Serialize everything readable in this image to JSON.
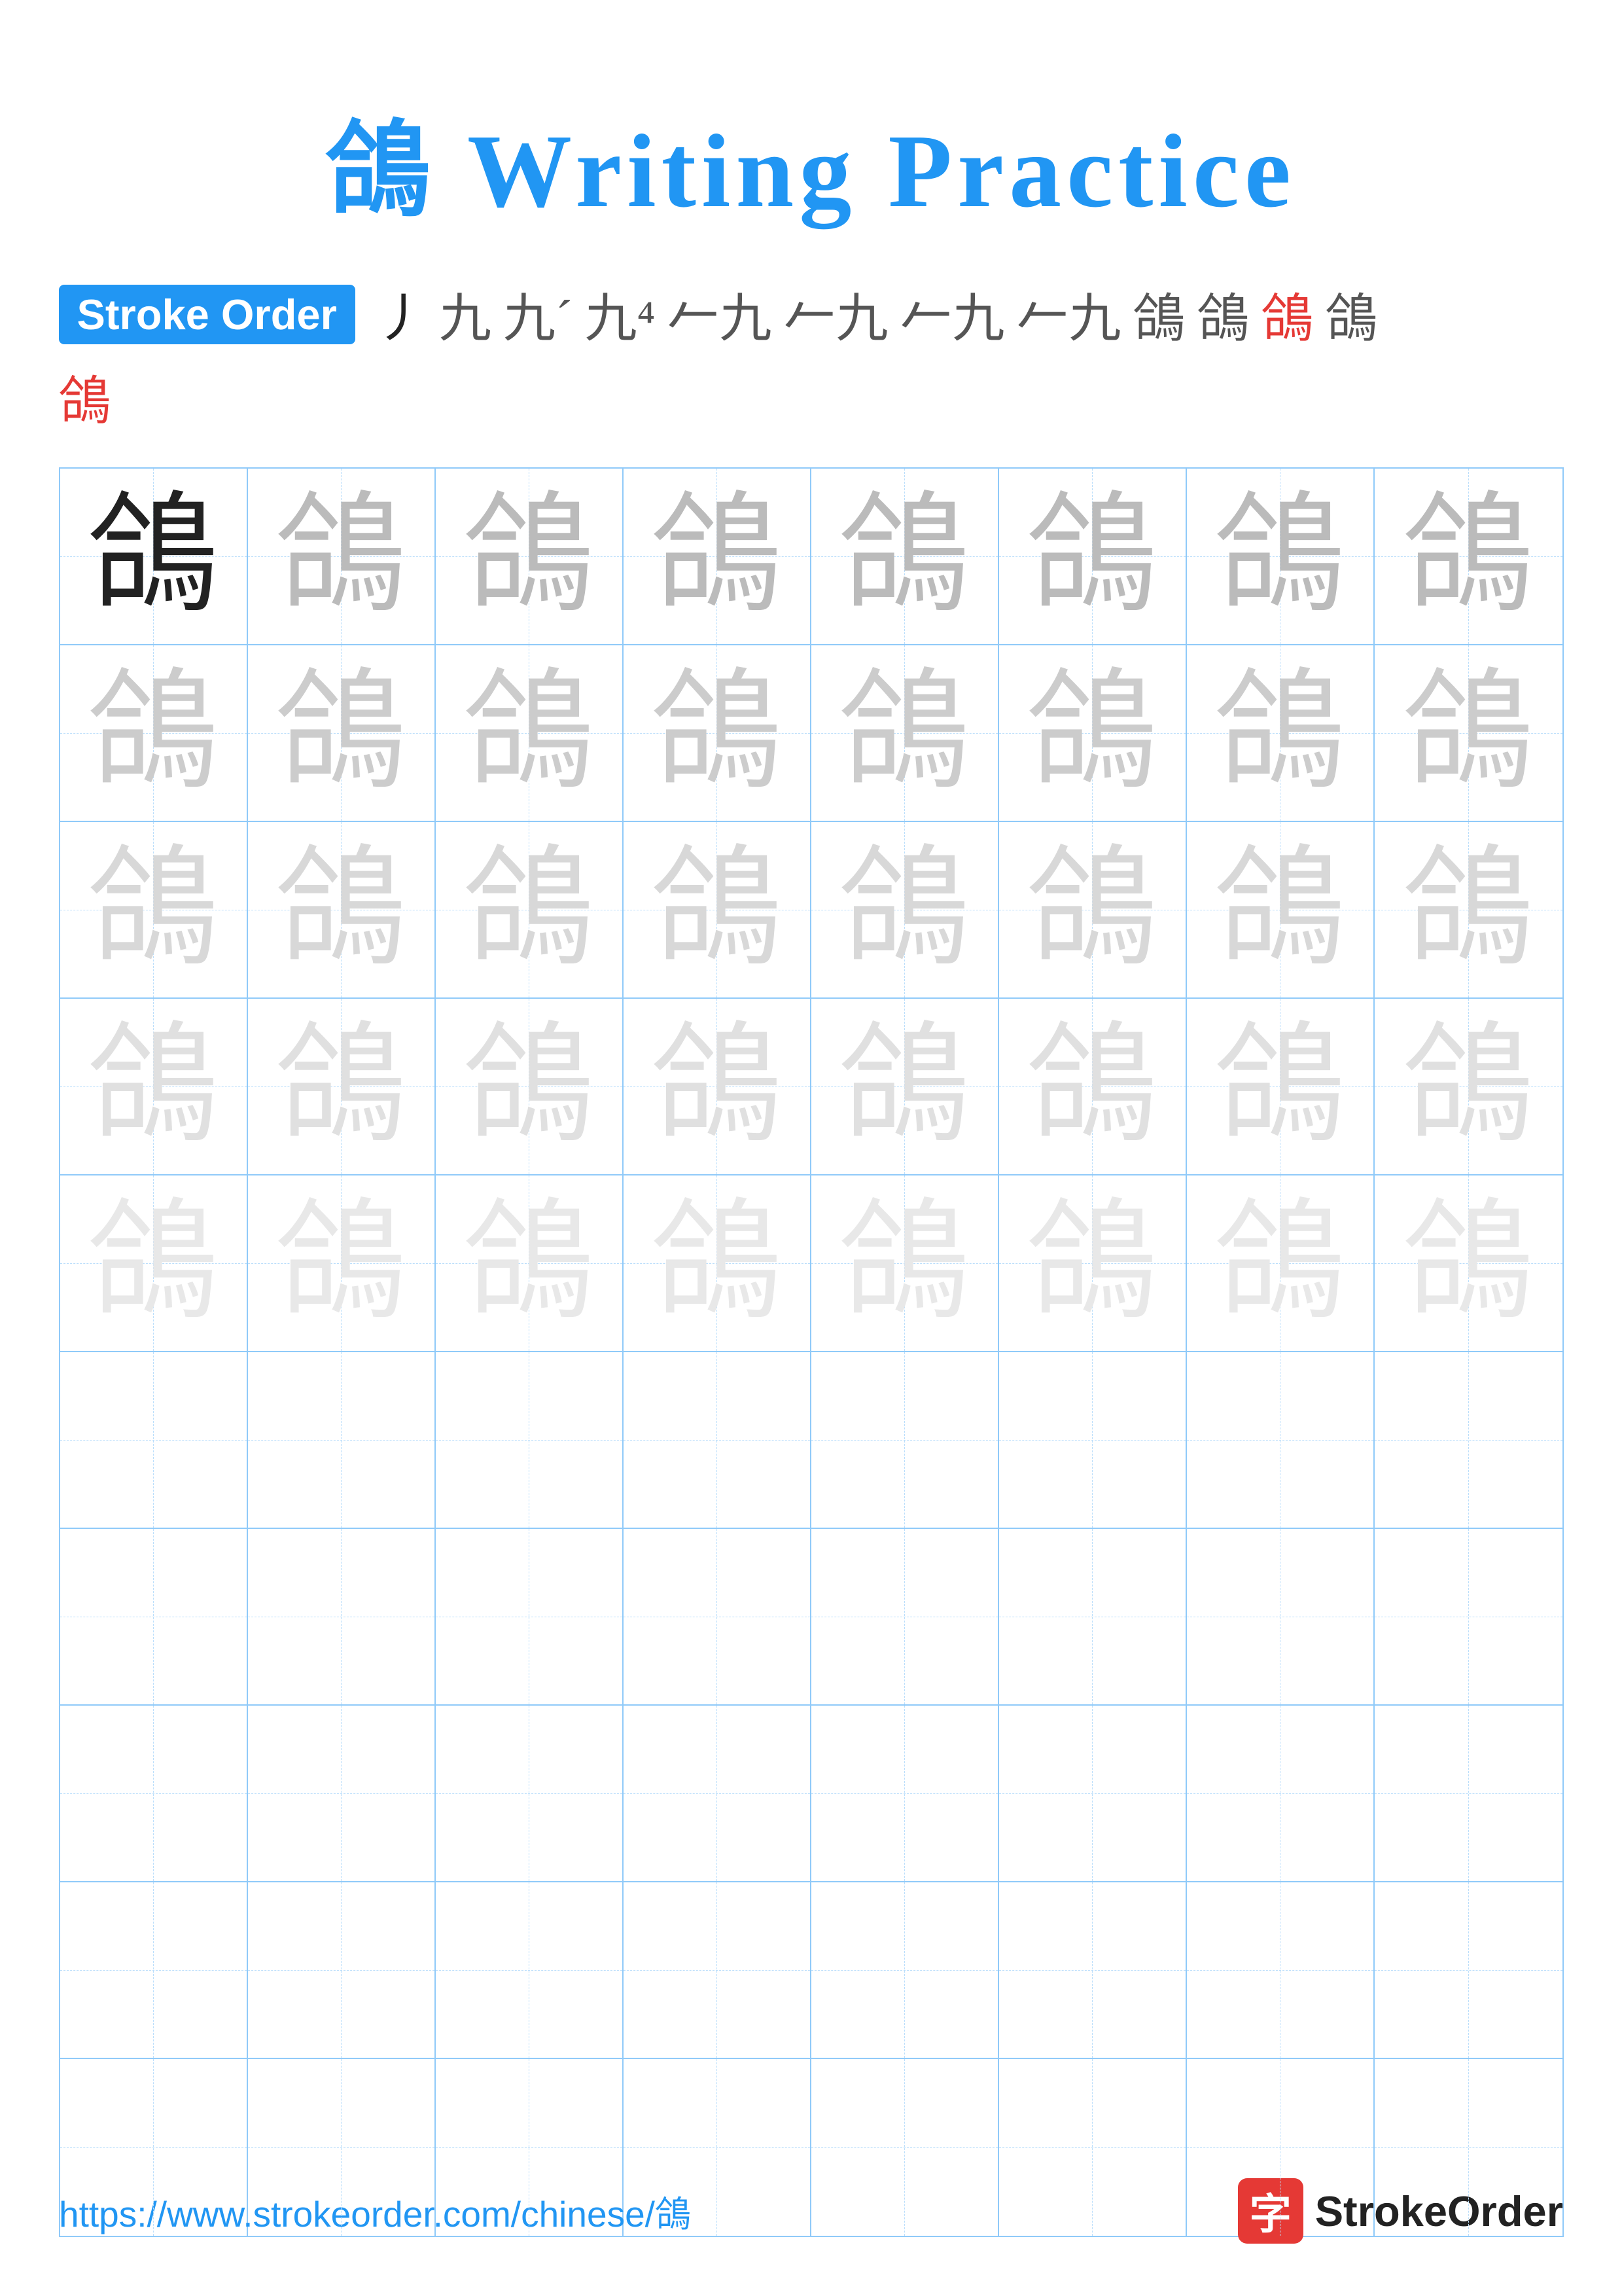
{
  "title": "鴿 Writing Practice",
  "stroke_order": {
    "badge_label": "Stroke Order",
    "strokes": [
      "丿",
      "九",
      "九´",
      "九´",
      "𠂉",
      "𠂉",
      "𠂉",
      "𠂉",
      "鴿",
      "鴿",
      "鴿",
      "鴿"
    ],
    "final_char": "鴿"
  },
  "grid": {
    "character": "鴿",
    "rows": 10,
    "cols": 8,
    "filled_rows": 5,
    "empty_rows": 5
  },
  "footer": {
    "url": "https://www.strokeorder.com/chinese/鴿",
    "brand_icon": "字",
    "brand_name": "StrokeOrder"
  }
}
